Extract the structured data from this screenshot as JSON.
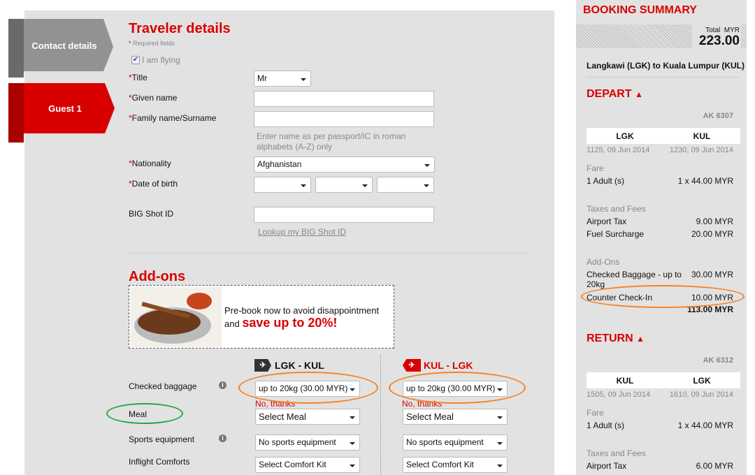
{
  "tabs": [
    {
      "label": "Contact details",
      "active": false
    },
    {
      "label": "Guest 1",
      "active": true
    }
  ],
  "traveler": {
    "title": "Traveler details",
    "required_note": "Required fields",
    "i_am_flying": "I am flying",
    "i_am_flying_checked": true,
    "title_label": "Title",
    "title_value": "Mr",
    "given_name_label": "Given name",
    "given_name_value": "",
    "family_name_label": "Family name/Surname",
    "family_name_value": "",
    "name_hint": "Enter name as per passport/IC in roman alphabets (A-Z) only",
    "nationality_label": "Nationality",
    "nationality_value": "Afghanistan",
    "dob_label": "Date of birth",
    "dob_day": "",
    "dob_month": "",
    "dob_year": "",
    "bigshot_label": "BIG Shot ID",
    "bigshot_value": "",
    "bigshot_link": "Lookup my BIG Shot ID"
  },
  "addons": {
    "title": "Add-ons",
    "banner": {
      "text1": "Pre-book now to avoid disappointment",
      "text2": "and",
      "text3": "save up to 20%!"
    },
    "columns": [
      {
        "route": "LGK - KUL",
        "icon": "plane-depart-icon"
      },
      {
        "route": "KUL - LGK",
        "icon": "plane-return-icon"
      }
    ],
    "rows": [
      {
        "label": "Checked baggage",
        "info": true,
        "values": [
          "up to 20kg (30.00 MYR)",
          "up to 20kg (30.00 MYR)"
        ],
        "note": "No, thanks"
      },
      {
        "label": "Meal",
        "info": false,
        "values": [
          "Select Meal",
          "Select Meal"
        ]
      },
      {
        "label": "Sports equipment",
        "info": true,
        "values": [
          "No sports equipment",
          "No sports equipment"
        ]
      },
      {
        "label": "Inflight Comforts",
        "info": false,
        "values": [
          "Select Comfort Kit",
          "Select Comfort Kit"
        ]
      }
    ]
  },
  "summary": {
    "title": "BOOKING SUMMARY",
    "total_label": "Total",
    "currency": "MYR",
    "total": "223.00",
    "route": "Langkawi (LGK) to Kuala Lumpur (KUL)",
    "depart": {
      "heading": "DEPART",
      "flight": "AK 6307",
      "from": "LGK",
      "to": "KUL",
      "dep_time": "1125, 09 Jun 2014",
      "arr_time": "1230, 09 Jun 2014",
      "fare_label": "Fare",
      "fare_pax": "1 Adult (s)",
      "fare_value": "1 x 44.00 MYR",
      "taxes_label": "Taxes and Fees",
      "airport_tax": "Airport Tax",
      "airport_tax_value": "9.00 MYR",
      "fuel": "Fuel Surcharge",
      "fuel_value": "20.00 MYR",
      "addons_label": "Add-Ons",
      "baggage": "Checked Baggage - up to 20kg",
      "baggage_value": "30.00 MYR",
      "checkin": "Counter Check-In",
      "checkin_value": "10.00 MYR",
      "subtotal": "113.00 MYR"
    },
    "return": {
      "heading": "RETURN",
      "flight": "AK 6312",
      "from": "KUL",
      "to": "LGK",
      "dep_time": "1505, 09 Jun 2014",
      "arr_time": "1610, 09 Jun 2014",
      "fare_label": "Fare",
      "fare_pax": "1 Adult (s)",
      "fare_value": "1 x 44.00 MYR",
      "taxes_label": "Taxes and Fees",
      "airport_tax": "Airport Tax",
      "airport_tax_value": "6.00 MYR"
    }
  },
  "colors": {
    "brand_red": "#d90000",
    "highlight_orange": "#f58220",
    "highlight_green": "#22aa44"
  }
}
